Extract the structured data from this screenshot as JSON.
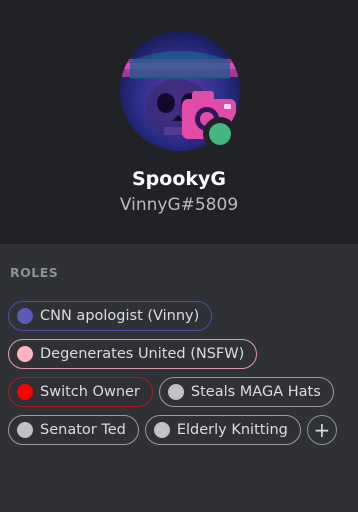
{
  "profile": {
    "username": "SpookyG",
    "tag": "VinnyG#5809",
    "avatar_icon": "skull-camera-avatar",
    "status": "online",
    "status_color": "#43b581"
  },
  "roles": {
    "header": "ROLES",
    "items": [
      {
        "name": "CNN apologist (Vinny)",
        "color": "#5a5bb5",
        "border": "#4f4fa0"
      },
      {
        "name": "Degenerates United (NSFW)",
        "color": "#ffb3c1",
        "border": "#d8a0ad"
      },
      {
        "name": "Switch Owner",
        "color": "#ff0000",
        "border": "#b31b1b"
      },
      {
        "name": "Steals MAGA Hats",
        "color": "#c0c2c4",
        "border": "#9a9c9e"
      },
      {
        "name": "Senator Ted",
        "color": "#c0c2c4",
        "border": "#9a9c9e"
      },
      {
        "name": "Elderly Knitting",
        "color": "#c0c2c4",
        "border": "#9a9c9e"
      }
    ],
    "add_icon": "plus-icon",
    "add_label": "+"
  }
}
